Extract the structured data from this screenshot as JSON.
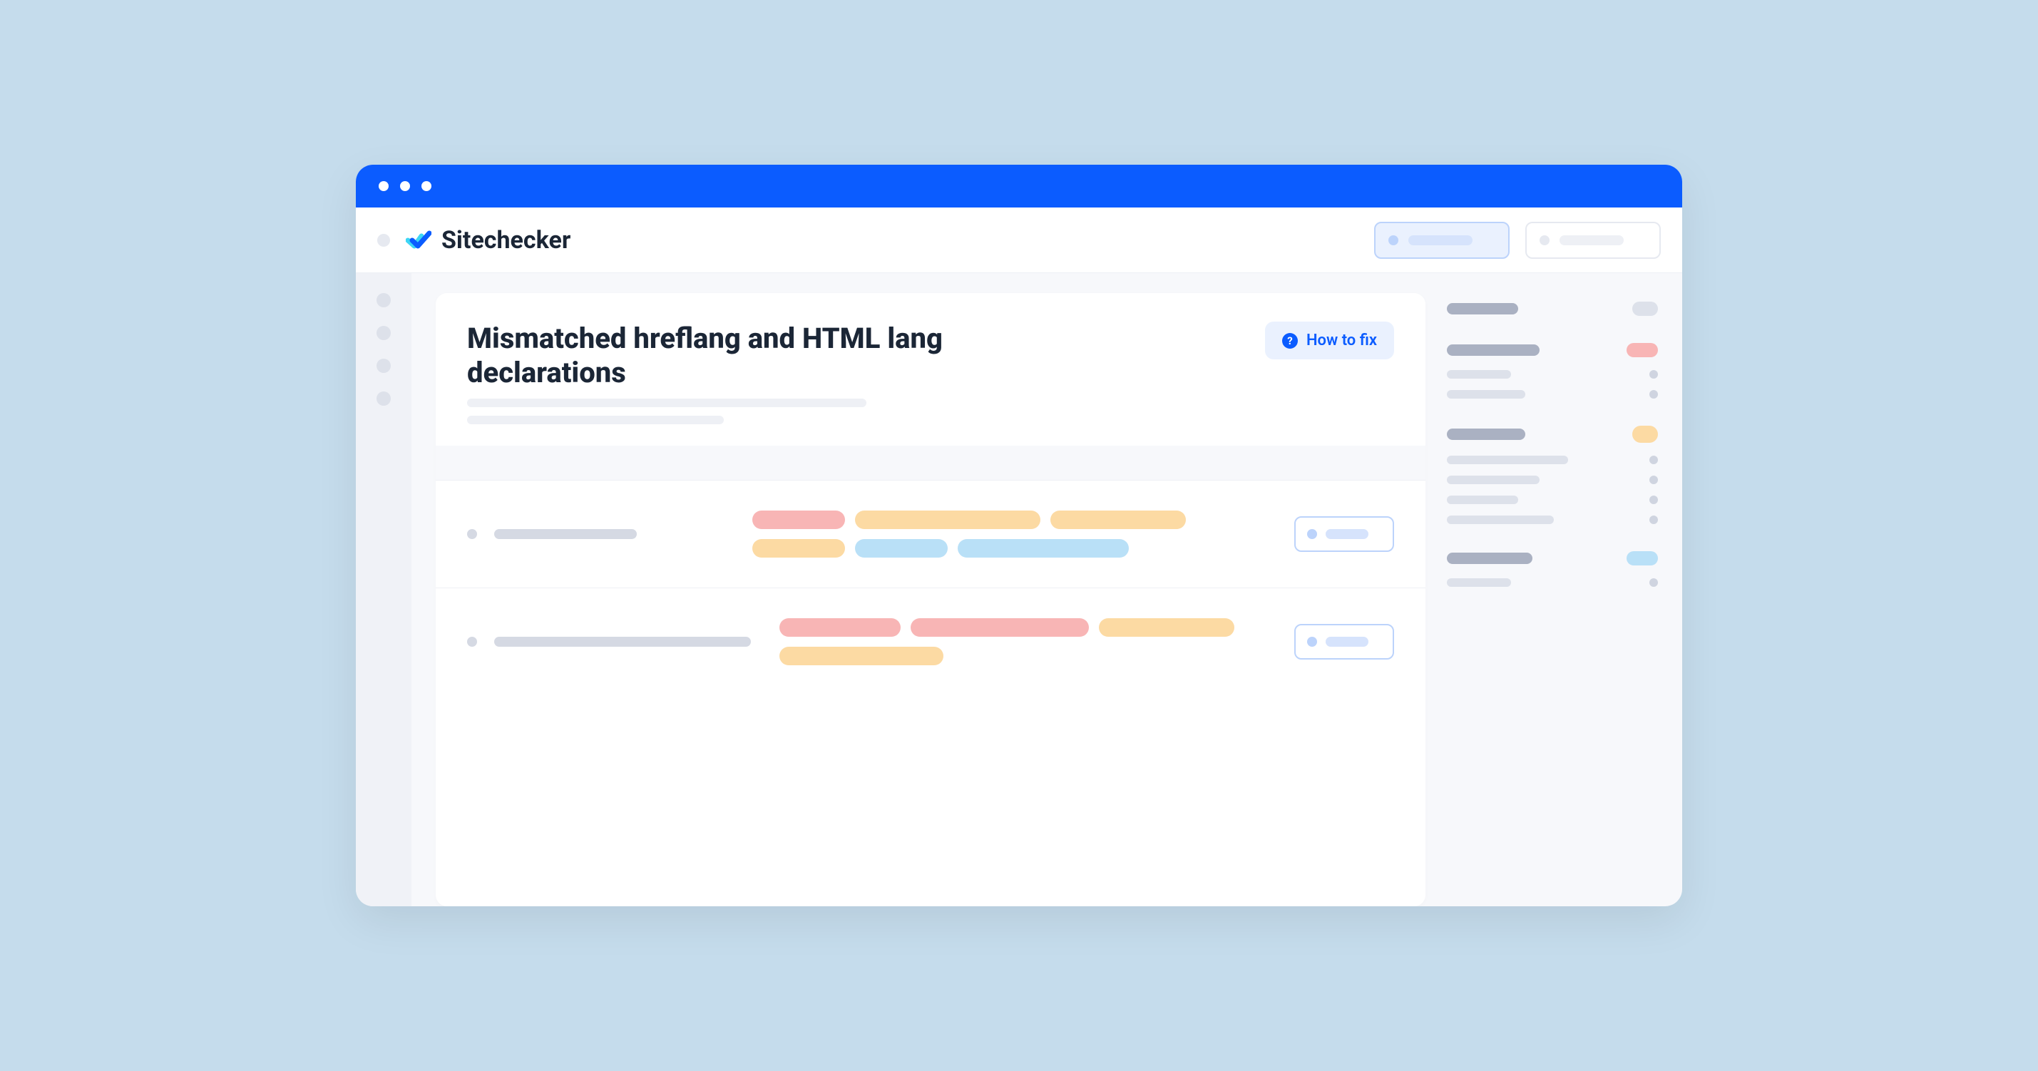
{
  "app": {
    "name": "Sitechecker"
  },
  "issue": {
    "title": "Mismatched hreflang and HTML lang declarations",
    "fix_button_label": "How to fix"
  }
}
